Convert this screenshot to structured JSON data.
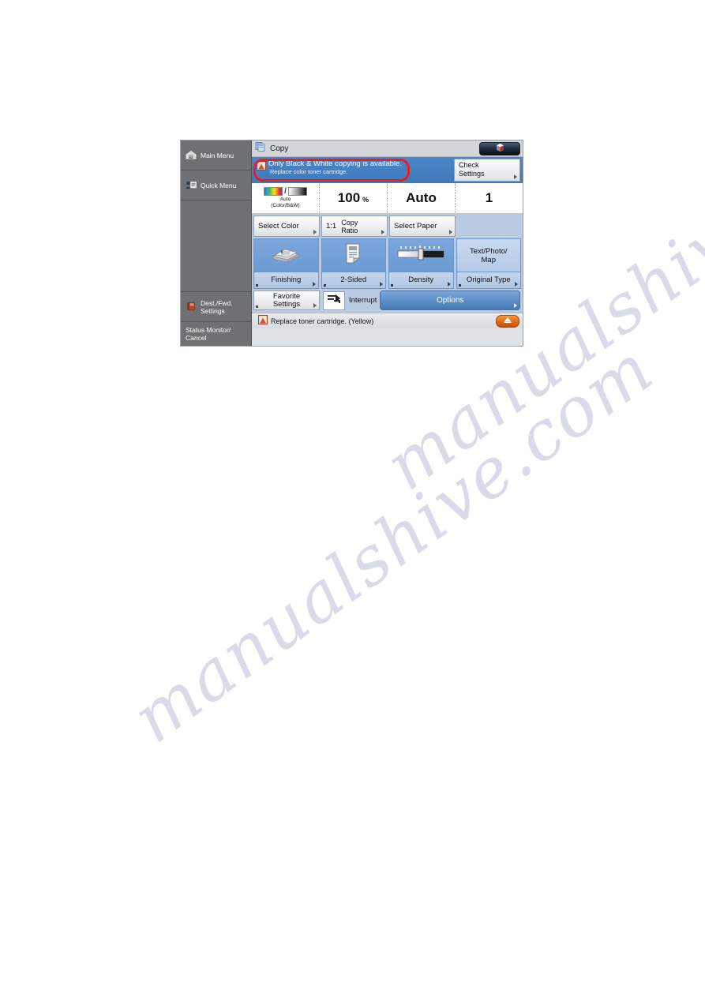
{
  "page": {
    "watermark_line1": "manualshive.com",
    "watermark_line2": "manualshive.com"
  },
  "panel": {
    "sidebar": {
      "items": [
        {
          "label": "Main Menu",
          "icon": "home-icon"
        },
        {
          "label": "Quick Menu",
          "icon": "quick-menu-icon"
        },
        {
          "label": "Dest./Fwd.\nSettings",
          "icon": "address-book-icon"
        },
        {
          "label": "Status Monitor/\nCancel",
          "icon": "none"
        }
      ]
    },
    "titlebar": {
      "title": "Copy",
      "icon": "copy-document-icon",
      "status_button_icon": "toner-cube-icon"
    },
    "message": {
      "line1": "Only Black & White copying is available.",
      "line2": "Replace color toner cartridge.",
      "icon": "toner-alert-icon",
      "highlight_color": "#ee1c1c",
      "check_settings_line1": "Check",
      "check_settings_line2": "Settings"
    },
    "values": [
      {
        "name": "color-mode",
        "icon": "color-bw-bar-icon",
        "line1": "Auto",
        "line2": "(Color/B&W)"
      },
      {
        "name": "copy-ratio",
        "big": "100",
        "unit": "%"
      },
      {
        "name": "paper-size",
        "big": "Auto"
      },
      {
        "name": "copy-count",
        "big": "1"
      }
    ],
    "select_row": {
      "select_color": "Select Color",
      "ratio_value": "1:1",
      "copy_ratio": "Copy\nRatio",
      "select_paper": "Select Paper"
    },
    "functions": [
      {
        "label": "Finishing",
        "icon": "finishing-stack-icon"
      },
      {
        "label": "2-Sided",
        "icon": "two-sided-page-icon"
      },
      {
        "label": "Density",
        "icon": "density-slider-icon"
      },
      {
        "top_text": "Text/Photo/\nMap",
        "label": "Original Type",
        "icon": "none"
      }
    ],
    "bottom": {
      "favorite_settings": "Favorite\nSettings",
      "interrupt": "Interrupt",
      "interrupt_icon": "interrupt-arrow-icon",
      "options": "Options"
    },
    "statusbar": {
      "text": "Replace toner cartridge. (Yellow)",
      "icon": "toner-alert-icon",
      "action_icon": "toner-replace-icon",
      "action_color": "#e06a16"
    }
  }
}
